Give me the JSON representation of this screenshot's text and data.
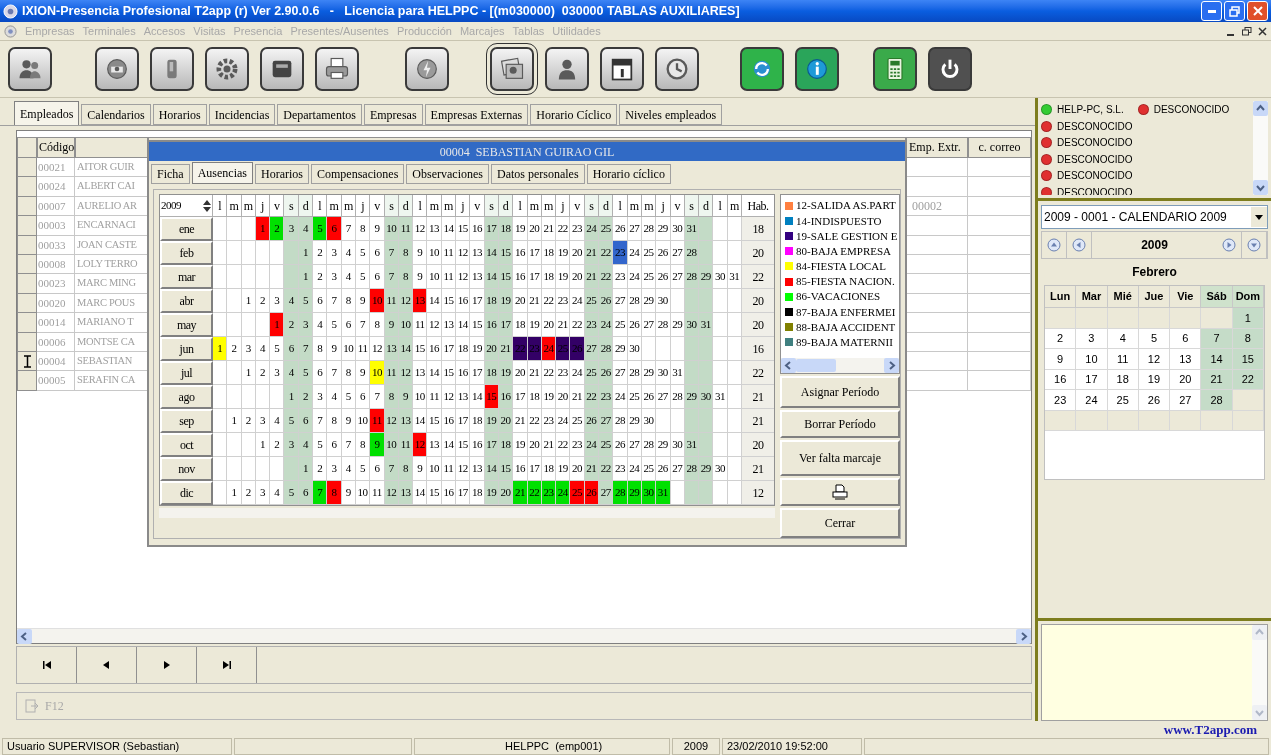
{
  "window": {
    "title": "IXION-Presencia Profesional T2app (r) Ver 2.90.0.6   -   Licencia para HELPPC - [(m030000)  030000 TABLAS AUXILIARES]"
  },
  "menu": [
    {
      "label": "Empresas",
      "disabled": true
    },
    {
      "label": "Terminales",
      "disabled": true
    },
    {
      "label": "Accesos",
      "disabled": true
    },
    {
      "label": "Visitas",
      "disabled": true
    },
    {
      "label": "Presencia",
      "disabled": true
    },
    {
      "label": "Presentes/Ausentes",
      "disabled": true
    },
    {
      "label": "Producción",
      "disabled": true
    },
    {
      "label": "Marcajes",
      "disabled": true
    },
    {
      "label": "Tablas",
      "disabled": true
    },
    {
      "label": "Utilidades",
      "disabled": true
    }
  ],
  "tabs": [
    {
      "label": "Empleados",
      "selected": true
    },
    {
      "label": "Calendarios",
      "selected": false
    },
    {
      "label": "Horarios",
      "selected": false
    },
    {
      "label": "Incidencias",
      "selected": false
    },
    {
      "label": "Departamentos",
      "selected": false
    },
    {
      "label": "Empresas",
      "selected": false
    },
    {
      "label": "Empresas Externas",
      "selected": false
    },
    {
      "label": "Horario Cíclico",
      "selected": false
    },
    {
      "label": "Niveles empleados",
      "selected": false
    }
  ],
  "employee_list": {
    "columns": [
      "Código",
      "Emp. Extr.",
      "c. correo"
    ],
    "rows": [
      {
        "code": "00021",
        "name": "AITOR GUIR",
        "selected": false
      },
      {
        "code": "00024",
        "name": "ALBERT CAI",
        "selected": false
      },
      {
        "code": "00007",
        "name": "AURELIO AR",
        "emp_extr": "00002",
        "selected": false
      },
      {
        "code": "00003",
        "name": "ENCARNACI",
        "selected": false
      },
      {
        "code": "00033",
        "name": "JOAN CASTE",
        "selected": false
      },
      {
        "code": "00008",
        "name": "LOLY TERRO",
        "selected": false
      },
      {
        "code": "00023",
        "name": "MARC MING",
        "selected": false
      },
      {
        "code": "00020",
        "name": "MARC POUS",
        "selected": false
      },
      {
        "code": "00014",
        "name": "MARIANO T",
        "selected": false
      },
      {
        "code": "00006",
        "name": "MONTSE CA",
        "selected": false
      },
      {
        "code": "00004",
        "name": "SEBASTIAN",
        "selected": true
      },
      {
        "code": "00005",
        "name": "SERAFIN CA",
        "selected": false
      }
    ]
  },
  "dialog": {
    "title": "00004  SEBASTIAN GUIRAO GIL",
    "tabs": [
      {
        "label": "Ficha",
        "selected": false
      },
      {
        "label": "Ausencias",
        "selected": true
      },
      {
        "label": "Horarios",
        "selected": false
      },
      {
        "label": "Compensaciones",
        "selected": false
      },
      {
        "label": "Observaciones",
        "selected": false
      },
      {
        "label": "Datos personales",
        "selected": false
      },
      {
        "label": "Horario cíclico",
        "selected": false
      }
    ],
    "calendar": {
      "year": "2009",
      "hab_label": "Hab.",
      "columns": [
        {
          "label": "l",
          "weekend": false
        },
        {
          "label": "m",
          "weekend": false
        },
        {
          "label": "m",
          "weekend": false
        },
        {
          "label": "j",
          "weekend": false
        },
        {
          "label": "v",
          "weekend": false
        },
        {
          "label": "s",
          "weekend": true
        },
        {
          "label": "d",
          "weekend": true
        },
        {
          "label": "l",
          "weekend": false
        },
        {
          "label": "m",
          "weekend": false
        },
        {
          "label": "m",
          "weekend": false
        },
        {
          "label": "j",
          "weekend": false
        },
        {
          "label": "v",
          "weekend": false
        },
        {
          "label": "s",
          "weekend": true
        },
        {
          "label": "d",
          "weekend": true
        },
        {
          "label": "l",
          "weekend": false
        },
        {
          "label": "m",
          "weekend": false
        },
        {
          "label": "m",
          "weekend": false
        },
        {
          "label": "j",
          "weekend": false
        },
        {
          "label": "v",
          "weekend": false
        },
        {
          "label": "s",
          "weekend": true
        },
        {
          "label": "d",
          "weekend": true
        },
        {
          "label": "l",
          "weekend": false
        },
        {
          "label": "m",
          "weekend": false
        },
        {
          "label": "m",
          "weekend": false
        },
        {
          "label": "j",
          "weekend": false
        },
        {
          "label": "v",
          "weekend": false
        },
        {
          "label": "s",
          "weekend": true
        },
        {
          "label": "d",
          "weekend": true
        },
        {
          "label": "l",
          "weekend": false
        },
        {
          "label": "m",
          "weekend": false
        },
        {
          "label": "m",
          "weekend": false
        },
        {
          "label": "j",
          "weekend": false
        },
        {
          "label": "v",
          "weekend": false
        },
        {
          "label": "s",
          "weekend": true
        },
        {
          "label": "d",
          "weekend": true
        },
        {
          "label": "l",
          "weekend": false
        },
        {
          "label": "m",
          "weekend": false
        }
      ],
      "months": [
        {
          "label": "ene",
          "hab": "18",
          "cells": [
            {
              "kind": "empty"
            },
            {
              "kind": "empty"
            },
            {
              "kind": "empty"
            },
            {
              "kind": "marked",
              "d": "1",
              "color": "#ff0000"
            },
            {
              "kind": "marked",
              "d": "2",
              "color": "#00e000"
            },
            "3",
            "4",
            {
              "kind": "marked",
              "d": "5",
              "color": "#00e000"
            },
            {
              "kind": "marked",
              "d": "6",
              "color": "#ff0000"
            },
            "7",
            "8",
            "9",
            "10",
            "11",
            "12",
            "13",
            "14",
            "15",
            "16",
            "17",
            "18",
            "19",
            "20",
            "21",
            "22",
            "23",
            "24",
            "25",
            "26",
            "27",
            "28",
            "29",
            "30",
            "31"
          ]
        },
        {
          "label": "feb",
          "hab": "20",
          "cells": [
            {
              "kind": "empty"
            },
            {
              "kind": "empty"
            },
            {
              "kind": "empty"
            },
            {
              "kind": "empty"
            },
            {
              "kind": "empty"
            },
            {
              "kind": "empty"
            },
            "1",
            "2",
            "3",
            "4",
            "5",
            "6",
            "7",
            "8",
            "9",
            "10",
            "11",
            "12",
            "13",
            "14",
            "15",
            "16",
            "17",
            "18",
            "19",
            "20",
            "21",
            "22",
            {
              "kind": "marked",
              "d": "23",
              "color": "#3366cc"
            },
            "24",
            "25",
            "26",
            "27",
            "28"
          ]
        },
        {
          "label": "mar",
          "hab": "22",
          "cells": [
            {
              "kind": "empty"
            },
            {
              "kind": "empty"
            },
            {
              "kind": "empty"
            },
            {
              "kind": "empty"
            },
            {
              "kind": "empty"
            },
            {
              "kind": "empty"
            },
            "1",
            "2",
            "3",
            "4",
            "5",
            "6",
            "7",
            "8",
            "9",
            "10",
            "11",
            "12",
            "13",
            "14",
            "15",
            "16",
            "17",
            "18",
            "19",
            "20",
            "21",
            "22",
            "23",
            "24",
            "25",
            "26",
            "27",
            "28",
            "29",
            "30",
            "31"
          ]
        },
        {
          "label": "abr",
          "hab": "20",
          "cells": [
            {
              "kind": "empty"
            },
            {
              "kind": "empty"
            },
            "1",
            "2",
            "3",
            "4",
            "5",
            "6",
            "7",
            "8",
            "9",
            {
              "kind": "marked",
              "d": "10",
              "color": "#ff0000"
            },
            "11",
            "12",
            {
              "kind": "marked",
              "d": "13",
              "color": "#ff0000"
            },
            "14",
            "15",
            "16",
            "17",
            "18",
            "19",
            "20",
            "21",
            "22",
            "23",
            "24",
            "25",
            "26",
            "27",
            "28",
            "29",
            "30"
          ]
        },
        {
          "label": "may",
          "hab": "20",
          "cells": [
            {
              "kind": "empty"
            },
            {
              "kind": "empty"
            },
            {
              "kind": "empty"
            },
            {
              "kind": "empty"
            },
            {
              "kind": "marked",
              "d": "1",
              "color": "#ff0000"
            },
            "2",
            "3",
            "4",
            "5",
            "6",
            "7",
            "8",
            "9",
            "10",
            "11",
            "12",
            "13",
            "14",
            "15",
            "16",
            "17",
            "18",
            "19",
            "20",
            "21",
            "22",
            "23",
            "24",
            "25",
            "26",
            "27",
            "28",
            "29",
            "30",
            "31"
          ]
        },
        {
          "label": "jun",
          "hab": "16",
          "cells": [
            {
              "kind": "marked",
              "d": "1",
              "color": "#ffff00"
            },
            "2",
            "3",
            "4",
            "5",
            "6",
            "7",
            "8",
            "9",
            "10",
            "11",
            "12",
            "13",
            "14",
            "15",
            "16",
            "17",
            "18",
            "19",
            "20",
            "21",
            {
              "kind": "marked",
              "d": "22",
              "color": "#330066"
            },
            {
              "kind": "marked",
              "d": "23",
              "color": "#330066"
            },
            {
              "kind": "marked",
              "d": "24",
              "color": "#ff0000"
            },
            {
              "kind": "marked",
              "d": "25",
              "color": "#330066"
            },
            {
              "kind": "marked",
              "d": "26",
              "color": "#330066"
            },
            "27",
            "28",
            "29",
            "30"
          ]
        },
        {
          "label": "jul",
          "hab": "22",
          "cells": [
            {
              "kind": "empty"
            },
            {
              "kind": "empty"
            },
            "1",
            "2",
            "3",
            "4",
            "5",
            "6",
            "7",
            "8",
            "9",
            {
              "kind": "marked",
              "d": "10",
              "color": "#ffff00"
            },
            "11",
            "12",
            "13",
            "14",
            "15",
            "16",
            "17",
            "18",
            "19",
            "20",
            "21",
            "22",
            "23",
            "24",
            "25",
            "26",
            "27",
            "28",
            "29",
            "30",
            "31"
          ]
        },
        {
          "label": "ago",
          "hab": "21",
          "cells": [
            {
              "kind": "empty"
            },
            {
              "kind": "empty"
            },
            {
              "kind": "empty"
            },
            {
              "kind": "empty"
            },
            {
              "kind": "empty"
            },
            "1",
            "2",
            "3",
            "4",
            "5",
            "6",
            "7",
            "8",
            "9",
            "10",
            "11",
            "12",
            "13",
            "14",
            {
              "kind": "marked",
              "d": "15",
              "color": "#ff0000"
            },
            "16",
            "17",
            "18",
            "19",
            "20",
            "21",
            "22",
            "23",
            "24",
            "25",
            "26",
            "27",
            "28",
            "29",
            "30",
            "31"
          ]
        },
        {
          "label": "sep",
          "hab": "21",
          "cells": [
            {
              "kind": "empty"
            },
            "1",
            "2",
            "3",
            "4",
            "5",
            "6",
            "7",
            "8",
            "9",
            "10",
            {
              "kind": "marked",
              "d": "11",
              "color": "#ff0000"
            },
            "12",
            "13",
            "14",
            "15",
            "16",
            "17",
            "18",
            "19",
            "20",
            "21",
            "22",
            "23",
            "24",
            "25",
            "26",
            "27",
            "28",
            "29",
            "30"
          ]
        },
        {
          "label": "oct",
          "hab": "20",
          "cells": [
            {
              "kind": "empty"
            },
            {
              "kind": "empty"
            },
            {
              "kind": "empty"
            },
            "1",
            "2",
            "3",
            "4",
            "5",
            "6",
            "7",
            "8",
            {
              "kind": "marked",
              "d": "9",
              "color": "#00e000"
            },
            "10",
            "11",
            {
              "kind": "marked",
              "d": "12",
              "color": "#ff0000"
            },
            "13",
            "14",
            "15",
            "16",
            "17",
            "18",
            "19",
            "20",
            "21",
            "22",
            "23",
            "24",
            "25",
            "26",
            "27",
            "28",
            "29",
            "30",
            "31"
          ]
        },
        {
          "label": "nov",
          "hab": "21",
          "cells": [
            {
              "kind": "empty"
            },
            {
              "kind": "empty"
            },
            {
              "kind": "empty"
            },
            {
              "kind": "empty"
            },
            {
              "kind": "empty"
            },
            {
              "kind": "empty"
            },
            "1",
            "2",
            "3",
            "4",
            "5",
            "6",
            "7",
            "8",
            "9",
            "10",
            "11",
            "12",
            "13",
            "14",
            "15",
            "16",
            "17",
            "18",
            "19",
            "20",
            "21",
            "22",
            "23",
            "24",
            "25",
            "26",
            "27",
            "28",
            "29",
            "30"
          ]
        },
        {
          "label": "dic",
          "hab": "12",
          "cells": [
            {
              "kind": "empty"
            },
            "1",
            "2",
            "3",
            "4",
            "5",
            "6",
            {
              "kind": "marked",
              "d": "7",
              "color": "#00e000"
            },
            {
              "kind": "marked",
              "d": "8",
              "color": "#ff0000"
            },
            "9",
            "10",
            "11",
            "12",
            "13",
            "14",
            "15",
            "16",
            "17",
            "18",
            "19",
            "20",
            {
              "kind": "marked",
              "d": "21",
              "color": "#00e000"
            },
            {
              "kind": "marked",
              "d": "22",
              "color": "#00e000"
            },
            {
              "kind": "marked",
              "d": "23",
              "color": "#00e000"
            },
            {
              "kind": "marked",
              "d": "24",
              "color": "#00e000"
            },
            {
              "kind": "marked",
              "d": "25",
              "color": "#ff0000"
            },
            {
              "kind": "marked",
              "d": "26",
              "color": "#ff0000"
            },
            "27",
            {
              "kind": "marked",
              "d": "28",
              "color": "#00e000"
            },
            {
              "kind": "marked",
              "d": "29",
              "color": "#00e000"
            },
            {
              "kind": "marked",
              "d": "30",
              "color": "#00e000"
            },
            {
              "kind": "marked",
              "d": "31",
              "color": "#00e000"
            }
          ]
        }
      ]
    },
    "legend": [
      {
        "label": "12-SALIDA AS.PART",
        "color": "#ff8040"
      },
      {
        "label": "14-INDISPUESTO",
        "color": "#0080c0"
      },
      {
        "label": "19-SALE GESTION E",
        "color": "#330080"
      },
      {
        "label": "80-BAJA EMPRESA",
        "color": "#ff00ff"
      },
      {
        "label": "84-FIESTA LOCAL",
        "color": "#ffff00"
      },
      {
        "label": "85-FIESTA NACION.",
        "color": "#ff0000"
      },
      {
        "label": "86-VACACIONES",
        "color": "#00ff00"
      },
      {
        "label": "87-BAJA ENFERMEI",
        "color": "#000000"
      },
      {
        "label": "88-BAJA ACCIDENT",
        "color": "#808000"
      },
      {
        "label": "89-BAJA MATERNII",
        "color": "#408080"
      }
    ],
    "buttons": [
      {
        "kind": "text",
        "label": "Asignar Período"
      },
      {
        "kind": "text",
        "label": "Borrar Período"
      },
      {
        "kind": "text",
        "label": "Ver falta marcaje"
      },
      {
        "kind": "print"
      },
      {
        "kind": "text",
        "label": "Cerrar"
      }
    ]
  },
  "status_list": {
    "rows": [
      [
        {
          "label": "HELP-PC, S.L.",
          "color": "#33cc33"
        },
        {
          "label": "DESCONOCIDO",
          "color": "#e03030"
        }
      ],
      [
        {
          "label": "DESCONOCIDO",
          "color": "#e03030"
        }
      ],
      [
        {
          "label": "DESCONOCIDO",
          "color": "#e03030"
        }
      ],
      [
        {
          "label": "DESCONOCIDO",
          "color": "#e03030"
        }
      ],
      [
        {
          "label": "DESCONOCIDO",
          "color": "#e03030"
        }
      ],
      [
        {
          "label": "DESCONOCIDO",
          "color": "#e03030"
        }
      ]
    ]
  },
  "calendar_panel": {
    "selector": "2009 - 0001 - CALENDARIO 2009",
    "year": "2009",
    "month": "Febrero",
    "weekdays": [
      {
        "label": "Lun",
        "weekend": false
      },
      {
        "label": "Mar",
        "weekend": false
      },
      {
        "label": "Mié",
        "weekend": false
      },
      {
        "label": "Jue",
        "weekend": false
      },
      {
        "label": "Vie",
        "weekend": false
      },
      {
        "label": "Sáb",
        "weekend": true
      },
      {
        "label": "Dom",
        "weekend": true
      }
    ],
    "weeks": [
      [
        {
          "kind": "empty"
        },
        {
          "kind": "empty"
        },
        {
          "kind": "empty"
        },
        {
          "kind": "empty"
        },
        {
          "kind": "empty"
        },
        {
          "kind": "empty"
        },
        "1"
      ],
      [
        "2",
        "3",
        "4",
        "5",
        "6",
        "7",
        "8"
      ],
      [
        "9",
        "10",
        "11",
        "12",
        "13",
        "14",
        "15"
      ],
      [
        "16",
        "17",
        "18",
        "19",
        "20",
        "21",
        "22"
      ],
      [
        "23",
        "24",
        "25",
        "26",
        "27",
        "28",
        {
          "kind": "empty"
        }
      ],
      [
        {
          "kind": "empty"
        },
        {
          "kind": "empty"
        },
        {
          "kind": "empty"
        },
        {
          "kind": "empty"
        },
        {
          "kind": "empty"
        },
        {
          "kind": "empty"
        },
        {
          "kind": "empty"
        }
      ]
    ]
  },
  "shortcut": "F12",
  "link": "www.T2app.com",
  "status_bar": [
    "Usuario SUPERVISOR (Sebastian)",
    "HELPPC  (emp001)",
    "2009",
    "23/02/2010 19:52:00"
  ]
}
